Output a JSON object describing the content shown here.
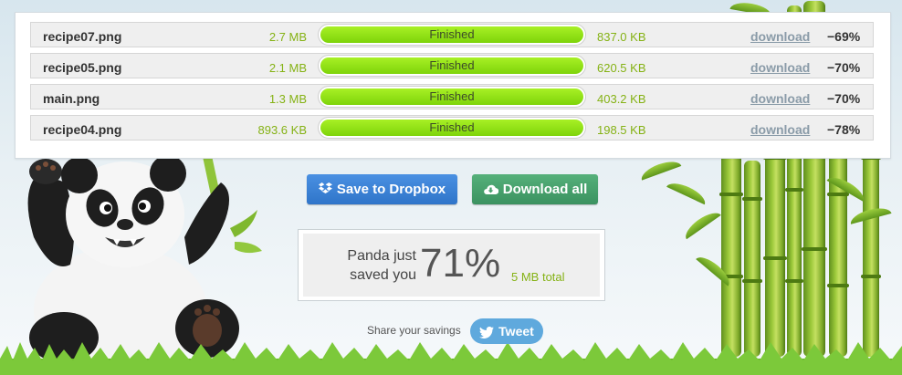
{
  "files": [
    {
      "name": "recipe07.png",
      "original_size": "2.7 MB",
      "status": "Finished",
      "progress": 1.0,
      "new_size": "837.0 KB",
      "download_label": "download",
      "savings": "−69%"
    },
    {
      "name": "recipe05.png",
      "original_size": "2.1 MB",
      "status": "Finished",
      "progress": 1.0,
      "new_size": "620.5 KB",
      "download_label": "download",
      "savings": "−70%"
    },
    {
      "name": "main.png",
      "original_size": "1.3 MB",
      "status": "Finished",
      "progress": 1.0,
      "new_size": "403.2 KB",
      "download_label": "download",
      "savings": "−70%"
    },
    {
      "name": "recipe04.png",
      "original_size": "893.6 KB",
      "status": "Finished",
      "progress": 1.0,
      "new_size": "198.5 KB",
      "download_label": "download",
      "savings": "−78%"
    }
  ],
  "actions": {
    "dropbox_label": "Save to Dropbox",
    "dropbox_icon": "dropbox-icon",
    "download_all_label": "Download all",
    "download_all_icon": "cloud-download-icon"
  },
  "summary": {
    "text_line1": "Panda just",
    "text_line2": "saved you",
    "percent": "71%",
    "total": "5 MB total"
  },
  "share": {
    "label": "Share your savings",
    "tweet_label": "Tweet",
    "tweet_icon": "twitter-bird-icon"
  },
  "colors": {
    "accent_green": "#85b215",
    "progress_fill": "#8fe014",
    "dropbox_blue": "#3b82d6",
    "download_green": "#47a06c",
    "tweet_blue": "#5fa9dd"
  }
}
